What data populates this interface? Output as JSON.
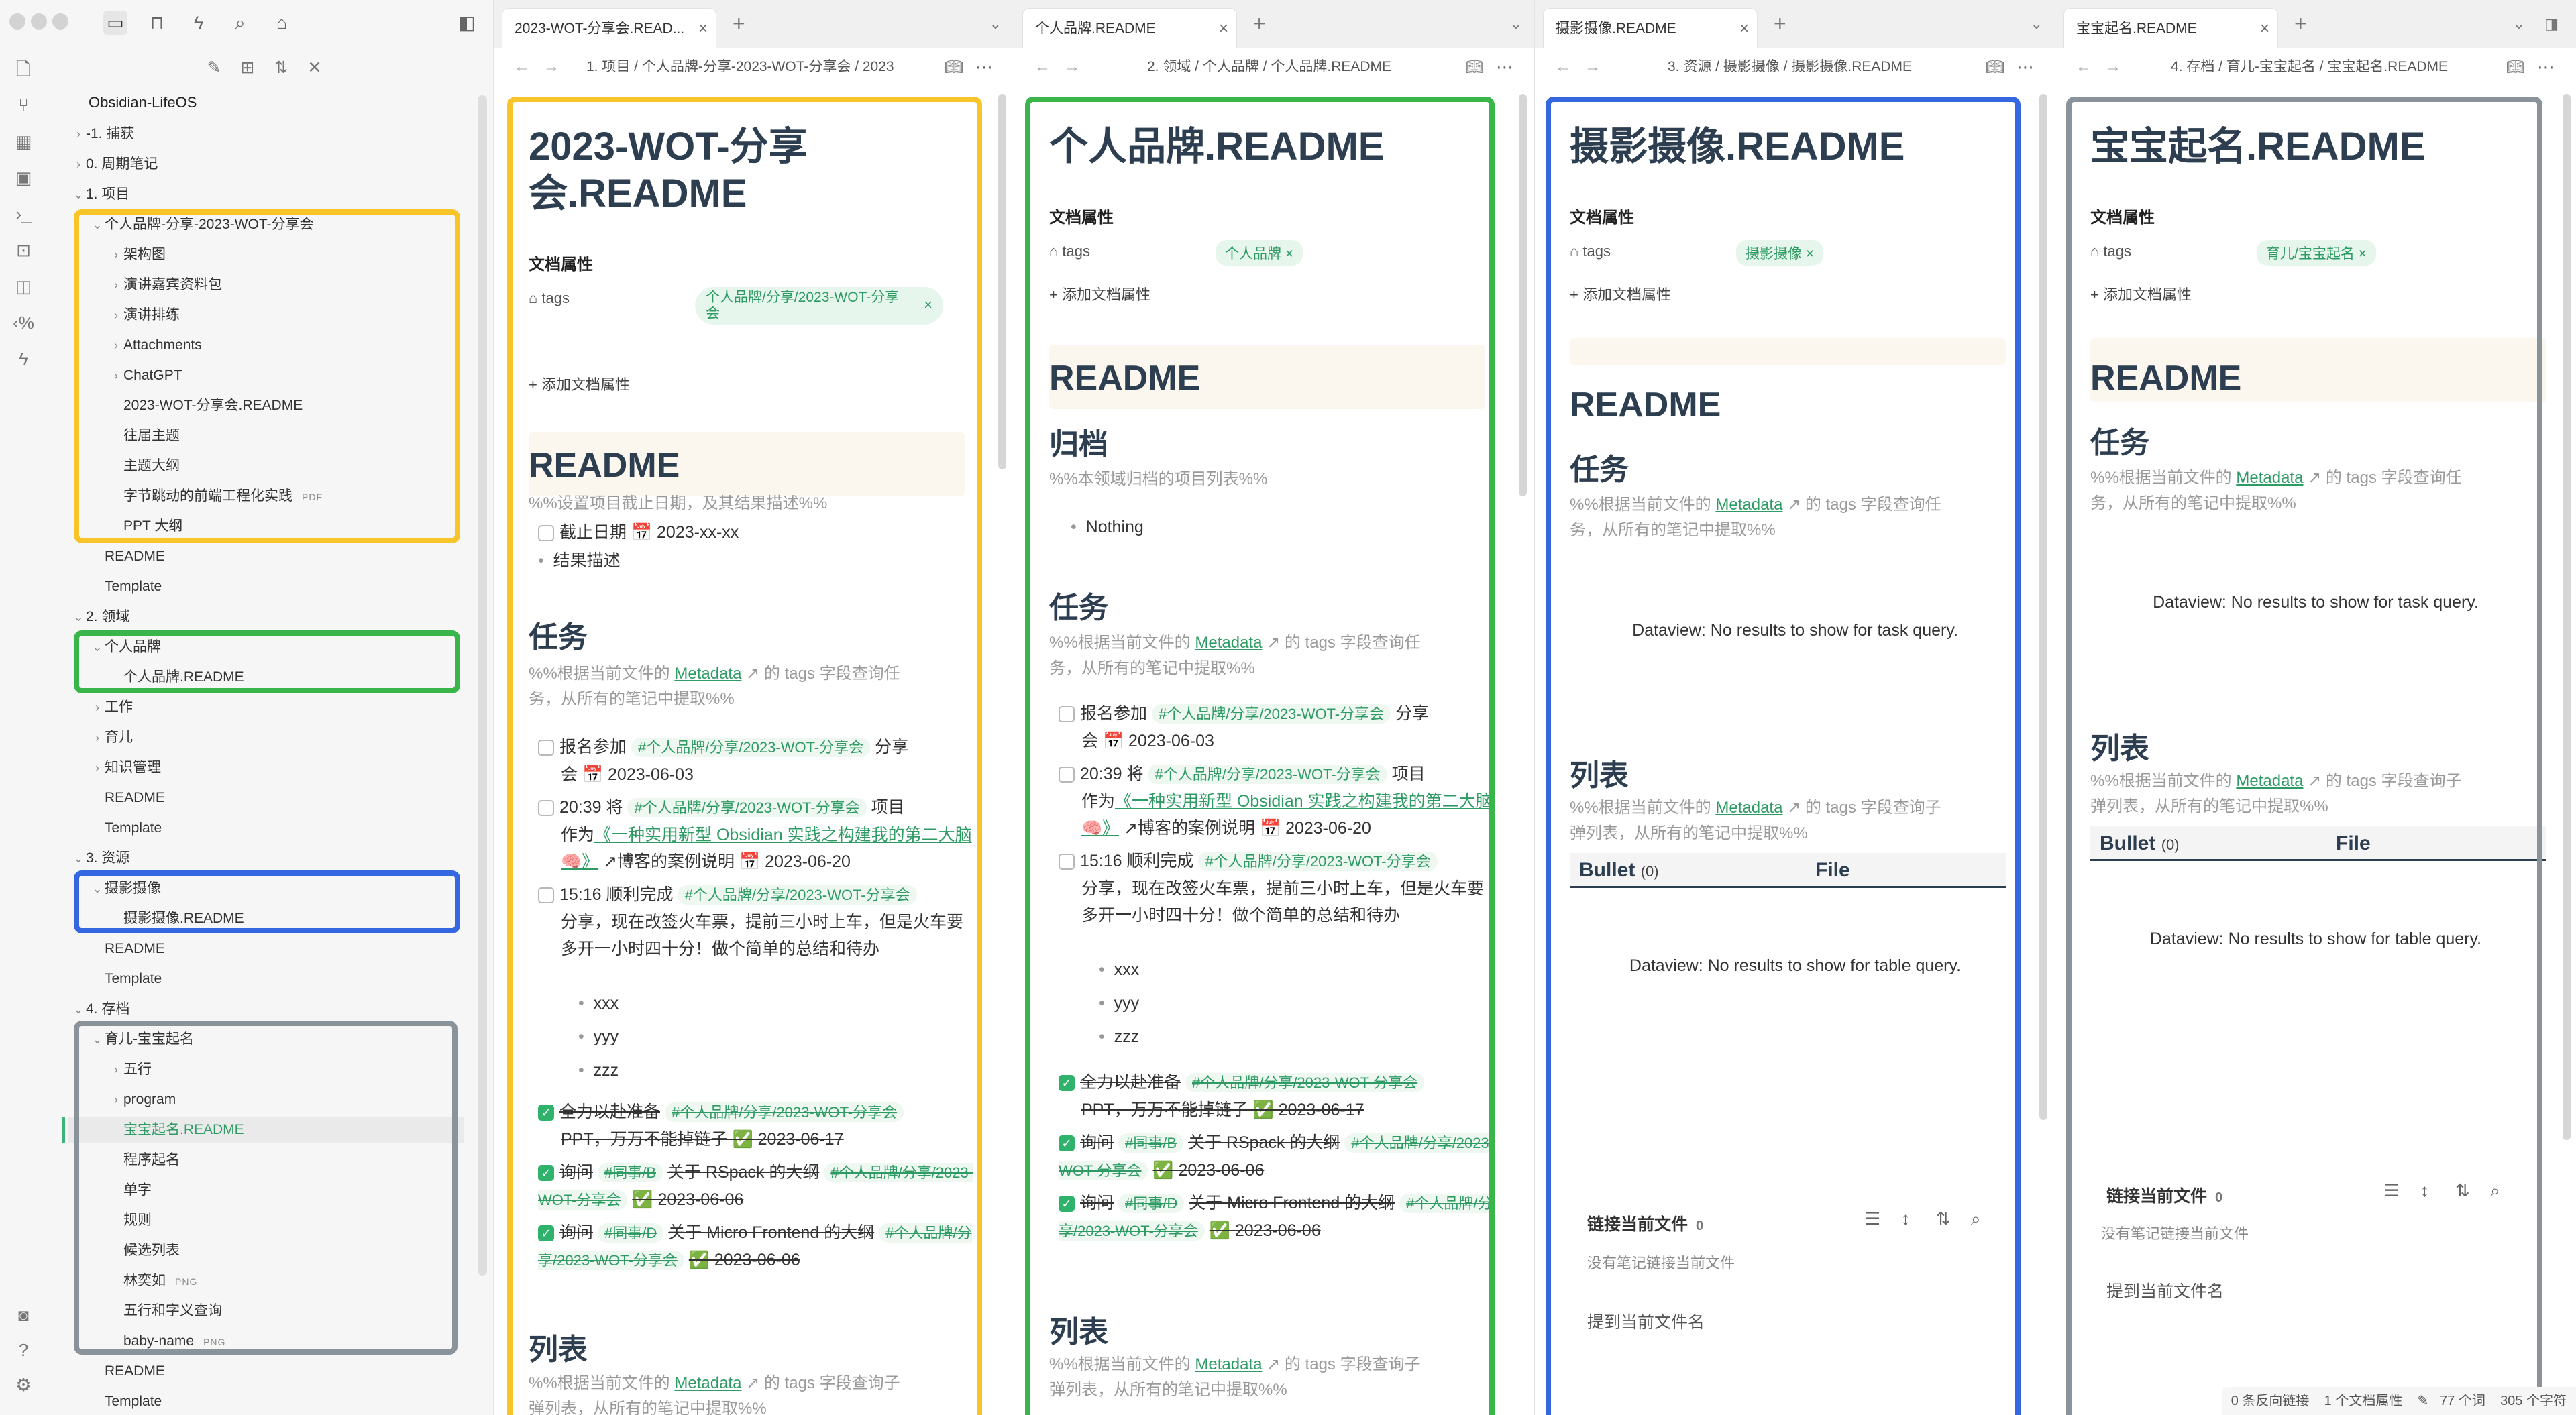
{
  "colors": {
    "accent": "#2d9b63",
    "yellow": "#f7c52a",
    "green": "#39b54a",
    "blue": "#3568e0",
    "gray": "#8a929a"
  },
  "explorer": {
    "vault_name": "Obsidian-LifeOS",
    "items": [
      {
        "label": "-1. 捕获",
        "chevron": "›"
      },
      {
        "label": "0. 周期笔记",
        "chevron": "›"
      },
      {
        "label": "1. 项目",
        "chevron": "⌄"
      },
      {
        "label": "个人品牌-分享-2023-WOT-分享会",
        "chevron": "⌄"
      },
      {
        "label": "架构图",
        "chevron": "›"
      },
      {
        "label": "演讲嘉宾资料包",
        "chevron": "›"
      },
      {
        "label": "演讲排练",
        "chevron": "›"
      },
      {
        "label": "Attachments",
        "chevron": "›"
      },
      {
        "label": "ChatGPT",
        "chevron": "›"
      },
      {
        "label": "2023-WOT-分享会.README",
        "chevron": ""
      },
      {
        "label": "往届主题",
        "chevron": ""
      },
      {
        "label": "主题大纲",
        "chevron": ""
      },
      {
        "label": "字节跳动的前端工程化实践",
        "chevron": "",
        "badge": "PDF"
      },
      {
        "label": "PPT 大纲",
        "chevron": ""
      },
      {
        "label": "README",
        "chevron": ""
      },
      {
        "label": "Template",
        "chevron": ""
      },
      {
        "label": "2. 领域",
        "chevron": "⌄"
      },
      {
        "label": "个人品牌",
        "chevron": "⌄"
      },
      {
        "label": "个人品牌.README",
        "chevron": ""
      },
      {
        "label": "工作",
        "chevron": "›"
      },
      {
        "label": "育儿",
        "chevron": "›"
      },
      {
        "label": "知识管理",
        "chevron": "›"
      },
      {
        "label": "README",
        "chevron": ""
      },
      {
        "label": "Template",
        "chevron": ""
      },
      {
        "label": "3. 资源",
        "chevron": "⌄"
      },
      {
        "label": "摄影摄像",
        "chevron": "⌄"
      },
      {
        "label": "摄影摄像.README",
        "chevron": ""
      },
      {
        "label": "README",
        "chevron": ""
      },
      {
        "label": "Template",
        "chevron": ""
      },
      {
        "label": "4. 存档",
        "chevron": "⌄"
      },
      {
        "label": "育儿-宝宝起名",
        "chevron": "⌄"
      },
      {
        "label": "五行",
        "chevron": "›"
      },
      {
        "label": "program",
        "chevron": "›"
      },
      {
        "label": "宝宝起名.README",
        "chevron": ""
      },
      {
        "label": "程序起名",
        "chevron": ""
      },
      {
        "label": "单字",
        "chevron": ""
      },
      {
        "label": "规则",
        "chevron": ""
      },
      {
        "label": "候选列表",
        "chevron": ""
      },
      {
        "label": "林奕如",
        "chevron": "",
        "badge": "PNG"
      },
      {
        "label": "五行和字义查询",
        "chevron": ""
      },
      {
        "label": "baby-name",
        "chevron": "",
        "badge": "PNG"
      },
      {
        "label": "README",
        "chevron": ""
      },
      {
        "label": "Template",
        "chevron": ""
      }
    ]
  },
  "panes": [
    {
      "tab_title": "2023-WOT-分享会.READ...",
      "breadcrumb": "1. 项目 / 个人品牌-分享-2023-WOT-分享会 / 2023",
      "title_line1": "2023-WOT-分享",
      "title_line2": "会.README",
      "props_label": "文档属性",
      "tags_label": "tags",
      "tag": "个人品牌/分享/2023-WOT-分享会",
      "add_prop": "添加文档属性",
      "readme": "README",
      "comment1": "%%设置项目截止日期，及其结果描述%%",
      "deadline": "截止日期 📅 2023-xx-xx",
      "result": "结果描述",
      "tasks_h": "任务",
      "tasks_comment_a": "%%根据当前文件的",
      "metadata": "Metadata",
      "tasks_comment_b": "的 tags 字段查询任",
      "tasks_comment_c": "务，从所有的笔记中提取%%",
      "list_h": "列表",
      "list_comment_a": "%%根据当前文件的",
      "list_comment_b": "的 tags 字段查询子",
      "list_comment_c": "弹列表，从所有的笔记中提取%%"
    },
    {
      "tab_title": "个人品牌.README",
      "breadcrumb": "2. 领域 / 个人品牌 / 个人品牌.README",
      "title": "个人品牌.README",
      "props_label": "文档属性",
      "tags_label": "tags",
      "tag": "个人品牌",
      "add_prop": "添加文档属性",
      "readme": "README",
      "archive_h": "归档",
      "archive_comment": "%%本领域归档的项目列表%%",
      "nothing": "Nothing",
      "tasks_h": "任务",
      "list_h": "列表"
    },
    {
      "tab_title": "摄影摄像.README",
      "breadcrumb": "3. 资源 / 摄影摄像 / 摄影摄像.README",
      "title": "摄影摄像.README",
      "props_label": "文档属性",
      "tags_label": "tags",
      "tag": "摄影摄像",
      "add_prop": "添加文档属性",
      "readme": "README",
      "tasks_h": "任务",
      "dv_task": "Dataview: No results to show for task query.",
      "list_h": "列表",
      "dv_table": "Dataview: No results to show for table query.",
      "bullet_col": "Bullet",
      "bullet_count": "(0)",
      "file_col": "File",
      "backlinks_title": "链接当前文件",
      "backlinks_count": "0",
      "no_backlinks": "没有笔记链接当前文件",
      "mentions": "提到当前文件名"
    },
    {
      "tab_title": "宝宝起名.README",
      "breadcrumb": "4. 存档 / 育儿-宝宝起名 / 宝宝起名.README",
      "title": "宝宝起名.README",
      "props_label": "文档属性",
      "tags_label": "tags",
      "tag": "育儿/宝宝起名",
      "add_prop": "添加文档属性",
      "readme": "README",
      "tasks_h": "任务",
      "dv_task": "Dataview: No results to show for task query.",
      "list_h": "列表",
      "dv_table": "Dataview: No results to show for table query.",
      "bullet_col": "Bullet",
      "bullet_count": "(0)",
      "file_col": "File",
      "backlinks_title": "链接当前文件",
      "backlinks_count": "0",
      "no_backlinks": "没有笔记链接当前文件",
      "mentions": "提到当前文件名"
    }
  ],
  "tasks": {
    "t1_pre": "报名参加",
    "t1_tag": "#个人品牌/分享/2023-WOT-分享会",
    "t1_post": "分享",
    "t1_date": "会 📅 2023-06-03",
    "t2_pre": "20:39 将",
    "t2_tag": "#个人品牌/分享/2023-WOT-分享会",
    "t2_post": "项目",
    "t2_link": "《一种实用新型 Obsidian 实践之构建我的第二大脑 🧠》",
    "t2_tail": "博客的案例说明 📅 2023-06-20",
    "t3_pre": "15:16 顺利完成",
    "t3_tag": "#个人品牌/分享/2023-WOT-分享会",
    "t3_body": "分享，现在改签火车票，提前三小时上车，但是火车要多开一小时四十分！做个简单的总结和待办",
    "sub": [
      "xxx",
      "yyy",
      "zzz"
    ],
    "d1_pre": "全力以赴准备",
    "d1_tag": "#个人品牌/分享/2023-WOT-分享会",
    "d1_tail": "PPT，万万不能掉链子 ✅ 2023-06-17",
    "d2_pre": "询问",
    "d2_tag1": "#同事/B",
    "d2_mid": "关于 RSpack 的大纲",
    "d2_tag2": "#个人品牌/分享/2023-WOT-分享会",
    "d2_date": "✅ 2023-06-06",
    "d3_pre": "询问",
    "d3_tag1": "#同事/D",
    "d3_mid": "关于 Micro Frontend 的大纲",
    "d3_tag2": "#个人品牌/分享/2023-WOT-分享会",
    "d3_date": "✅ 2023-06-06"
  },
  "status_bar": {
    "backlinks": "0 条反向链接",
    "props": "1 个文档属性",
    "words": "77 个词",
    "chars": "305 个字符"
  }
}
